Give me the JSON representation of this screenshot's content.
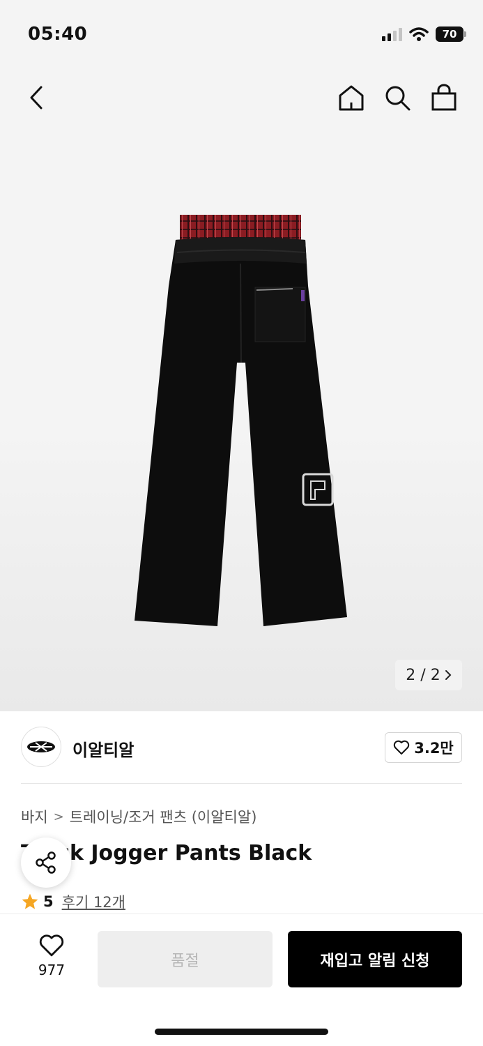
{
  "status_bar": {
    "time": "05:40",
    "battery": "70"
  },
  "nav": {
    "back_icon": "chevron-left-icon",
    "home_icon": "home-icon",
    "search_icon": "search-icon",
    "cart_icon": "shopping-bag-icon"
  },
  "gallery": {
    "pager_text": "2 / 2"
  },
  "brand": {
    "name": "이알티알",
    "like_count": "3.2만"
  },
  "breadcrumb": {
    "category": "바지",
    "subcategory": "트레이닝/조거 팬츠 (이알티알)"
  },
  "product": {
    "title": "Track Jogger Pants Black",
    "rating": "5",
    "review_link": "후기 12개"
  },
  "bottom_bar": {
    "wish_count": "977",
    "soldout_label": "품절",
    "restock_label": "재입고 알림 신청"
  },
  "colors": {
    "accent_star": "#f5a623",
    "primary_button": "#000000",
    "disabled_button": "#eeeeee"
  }
}
